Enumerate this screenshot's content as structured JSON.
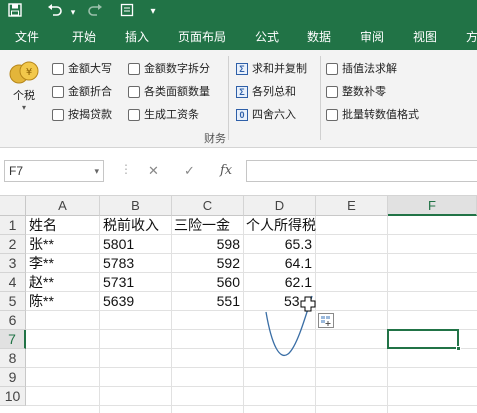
{
  "ribbon_tabs": [
    "文件",
    "开始",
    "插入",
    "页面布局",
    "公式",
    "数据",
    "审阅",
    "视图",
    "方"
  ],
  "ribbon": {
    "big_button_label": "个税",
    "col1": [
      "金额大写",
      "金额折合",
      "按揭贷款"
    ],
    "col2": [
      "金额数字拆分",
      "各类面额数量",
      "生成工资条"
    ],
    "col3": [
      "求和并复制",
      "各列总和",
      "四舍六入"
    ],
    "col4": [
      "插值法求解",
      "整数补零",
      "批量转数值格式"
    ],
    "group_label": "财务"
  },
  "formula_bar": {
    "name_box": "F7",
    "cancel_icon": "✕",
    "enter_icon": "✓",
    "fx_icon": "fx",
    "formula": ""
  },
  "grid": {
    "columns": [
      "A",
      "B",
      "C",
      "D",
      "E",
      "F"
    ],
    "rows": [
      "1",
      "2",
      "3",
      "4",
      "5",
      "6",
      "7",
      "8",
      "9",
      "10"
    ],
    "header_row": [
      "姓名",
      "税前收入",
      "三险一金",
      "个人所得税"
    ],
    "data": [
      [
        "张**",
        "5801",
        "598",
        "65.3"
      ],
      [
        "李**",
        "5783",
        "592",
        "64.1"
      ],
      [
        "赵**",
        "5731",
        "560",
        "62.1"
      ],
      [
        "陈**",
        "5639",
        "551",
        "53."
      ]
    ],
    "active_cell": "F7"
  },
  "colors": {
    "excel_green": "#217346",
    "ribbon_bg": "#f3f3f3",
    "selection": "#217346",
    "annotation_stroke": "#3a6ea5"
  }
}
